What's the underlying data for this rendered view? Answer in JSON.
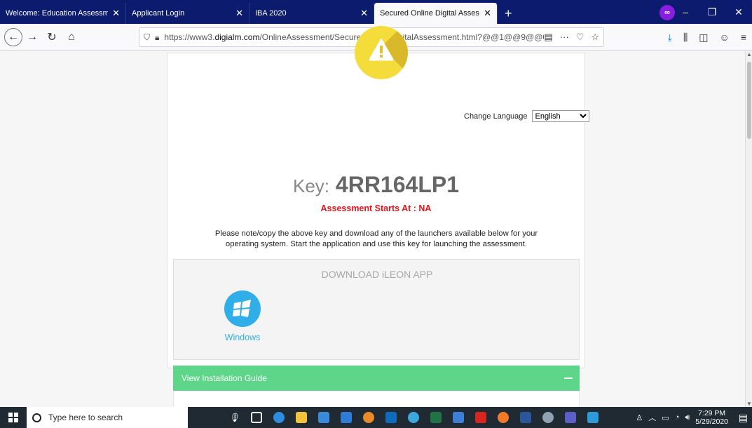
{
  "browser": {
    "tabs": [
      {
        "label": "Welcome: Education Assessment A",
        "close": "✕",
        "active": false
      },
      {
        "label": "Applicant Login",
        "close": "✕",
        "active": false
      },
      {
        "label": "IBA 2020",
        "close": "✕",
        "active": false
      },
      {
        "label": "Secured Online Digital Assessment",
        "close": "✕",
        "active": true
      }
    ],
    "new_tab": "+",
    "url_domain_prefix": "https://www3.",
    "url_domain": "digialm.com",
    "url_path": "/OnlineAssessment/SecuredOnlineDigitalAssessment.html?@@1@@9@@0@@",
    "window_controls": [
      "–",
      "❐",
      "✕"
    ]
  },
  "page": {
    "change_language_label": "Change Language",
    "language_selected": "English",
    "key_label": "Key:",
    "key_value": "4RR164LP1",
    "assessment_starts": "Assessment Starts At : NA",
    "note": "Please note/copy the above key and download any of the launchers available below for your operating system. Start the application and use this key for launching the assessment.",
    "download_title": "DOWNLOAD iLEON APP",
    "windows_label": "Windows",
    "installation_guide": "View Installation Guide",
    "accent_green": "#5dd68a",
    "accent_blue": "#2faee8",
    "alert_red": "#e4141b"
  },
  "taskbar": {
    "search_placeholder": "Type here to search",
    "time": "7:29 PM",
    "date": "5/29/2020"
  }
}
